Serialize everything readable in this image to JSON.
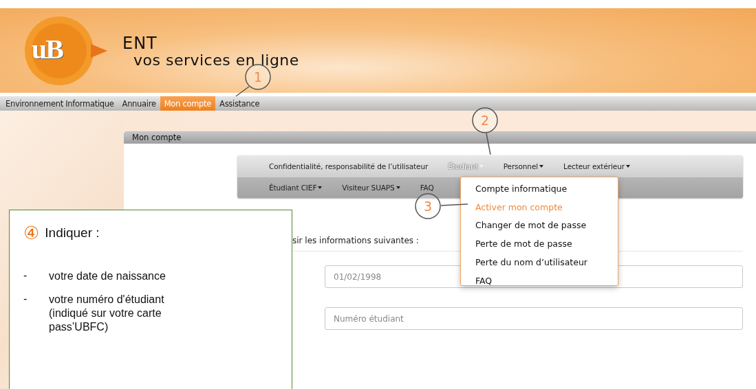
{
  "banner": {
    "logo_text": "uB",
    "title": "ENT",
    "subtitle": "vos services en ligne"
  },
  "nav": [
    {
      "label": "Environnement Informatique",
      "selected": false
    },
    {
      "label": "Annuaire",
      "selected": false
    },
    {
      "label": "Mon compte",
      "selected": true
    },
    {
      "label": "Assistance",
      "selected": false
    }
  ],
  "panel": {
    "title": "Mon compte"
  },
  "subnav": [
    [
      {
        "label": "Confidentialité, responsabilité de l’utilisateur",
        "has_menu": false,
        "selected": false
      },
      {
        "label": "Étudiant",
        "has_menu": true,
        "selected": true
      },
      {
        "label": "Personnel",
        "has_menu": true,
        "selected": false
      },
      {
        "label": "Lecteur extérieur",
        "has_menu": true,
        "selected": false
      }
    ],
    [
      {
        "label": "Étudiant CIEF",
        "has_menu": true,
        "selected": false
      },
      {
        "label": "Visiteur SUAPS",
        "has_menu": true,
        "selected": false
      },
      {
        "label": "FAQ",
        "has_menu": false,
        "selected": false
      }
    ]
  ],
  "dropdown": [
    {
      "label": "Compte informatique",
      "selected": false
    },
    {
      "label": "Activer mon compte",
      "selected": true
    },
    {
      "label": "Changer de mot de passe",
      "selected": false
    },
    {
      "label": "Perte de mot de passe",
      "selected": false
    },
    {
      "label": "Perte du nom d’utilisateur",
      "selected": false
    },
    {
      "label": "FAQ",
      "selected": false
    }
  ],
  "form": {
    "intro": "sir les informations suivantes :",
    "fields": [
      {
        "value": "01/02/1998"
      },
      {
        "placeholder": "Numéro étudiant"
      }
    ]
  },
  "callout": {
    "number": "④",
    "title": "Indiquer :",
    "items": [
      {
        "bullet": "-",
        "text": "votre date de naissance"
      },
      {
        "bullet": "-",
        "text": "votre numéro d'étudiant (indiqué sur votre carte pass’UBFC)"
      }
    ]
  },
  "markers": [
    {
      "label": "1"
    },
    {
      "label": "2"
    },
    {
      "label": "3"
    }
  ]
}
